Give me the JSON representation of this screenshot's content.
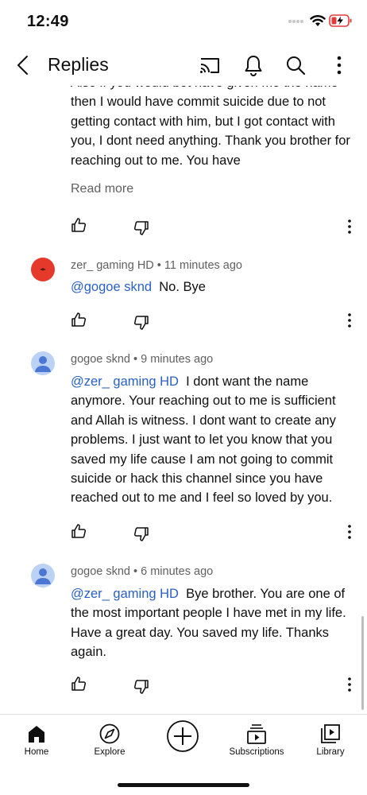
{
  "status": {
    "time": "12:49"
  },
  "header": {
    "title": "Replies"
  },
  "comments": [
    {
      "text": "Also if you would bot have given me the name then I would have commit suicide due to not getting contact with him, but I got contact with you, I dont need anything. Thank you brother for reaching out to me. You have",
      "read_more": "Read more"
    },
    {
      "author": "zer_ gaming HD",
      "time": "11 minutes ago",
      "mention": "@gogoe sknd",
      "text": "No. Bye"
    },
    {
      "author": "gogoe sknd",
      "time": "9 minutes ago",
      "mention": "@zer_ gaming HD",
      "text": "I dont want the name anymore. Your reaching out to me is sufficient and Allah is witness. I dont want to create any problems. I just want to let you know that you saved my life cause I am not going to commit suicide or hack this channel since you have reached out to me and I feel so loved  by you."
    },
    {
      "author": "gogoe sknd",
      "time": "6 minutes ago",
      "mention": "@zer_ gaming HD",
      "text": "Bye brother. You are one of the most important people I have met in my life. Have a great day. You saved my life. Thanks again."
    }
  ],
  "separator": "•",
  "nav": {
    "home": "Home",
    "explore": "Explore",
    "subscriptions": "Subscriptions",
    "library": "Library"
  },
  "colors": {
    "mention": "#2a5fc4",
    "meta": "#606060",
    "avatar_red": "#e53a2b",
    "avatar_blue": "#bcd2f4"
  }
}
